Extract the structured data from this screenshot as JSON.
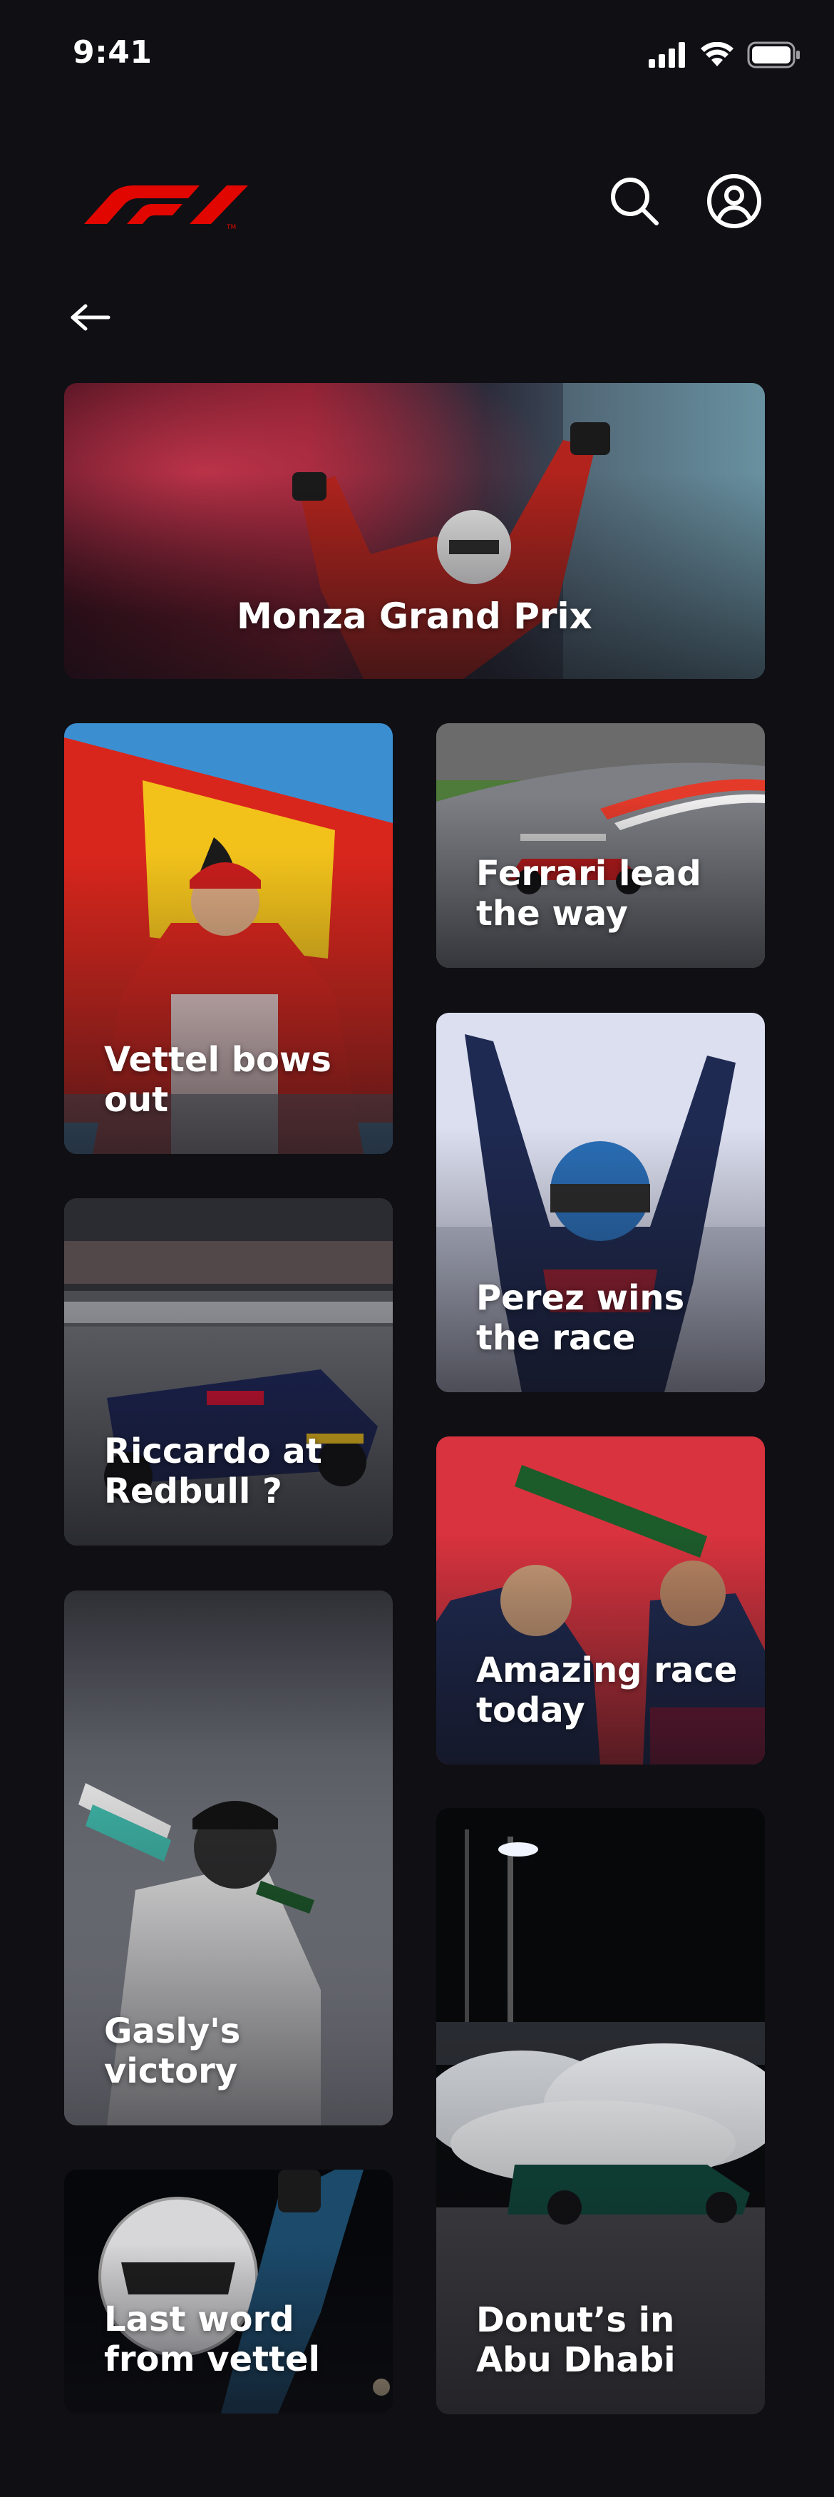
{
  "status_bar": {
    "time": "9:41"
  },
  "header": {
    "logo_text": "F1",
    "search_icon": "search-icon",
    "profile_icon": "user-circle-icon"
  },
  "nav": {
    "back_icon": "arrow-left-icon"
  },
  "colors": {
    "background": "#0f0f14",
    "brand_red": "#e10600",
    "text": "#ffffff"
  },
  "cards": {
    "hero": {
      "title": "Monza Grand Prix"
    },
    "vettel": {
      "title": "Vettel bows out"
    },
    "ferrari": {
      "title": "Ferrari lead the way"
    },
    "perez": {
      "title": "Perez wins the race"
    },
    "riccardo": {
      "title": "Riccardo at Redbull ?"
    },
    "amazing": {
      "title": "Amazing race today"
    },
    "gasly": {
      "title": "Gasly's victory"
    },
    "donut": {
      "title": "Donut’s in Abu Dhabi"
    },
    "last_word": {
      "title": "Last word from vettel"
    }
  }
}
